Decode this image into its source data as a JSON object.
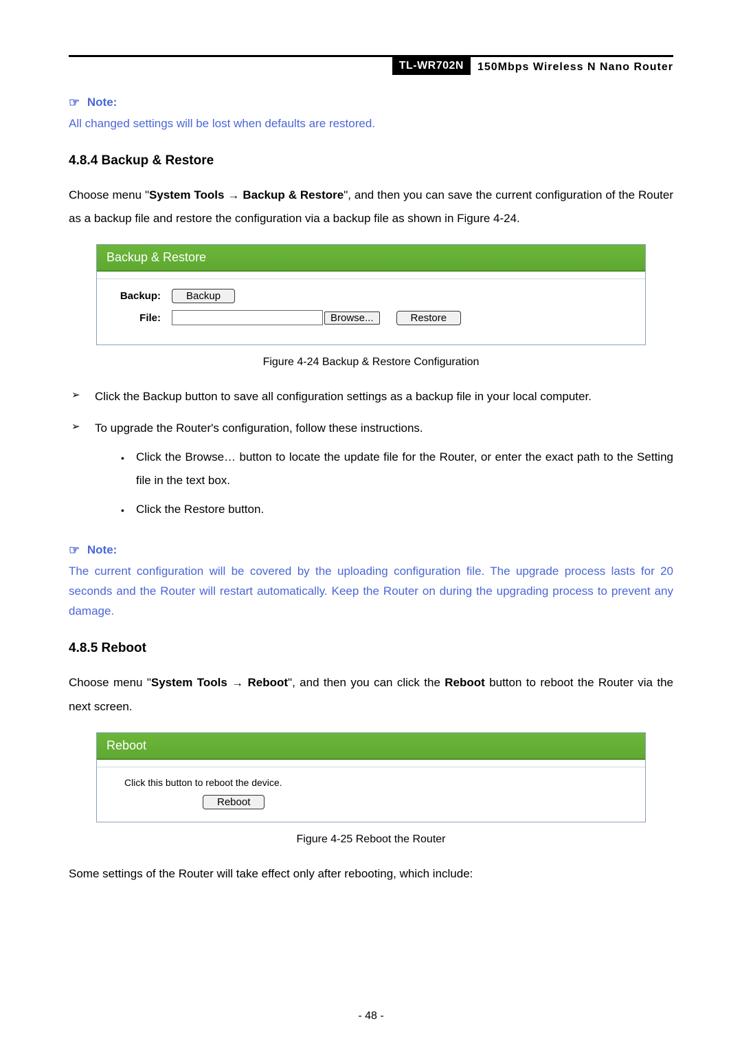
{
  "header": {
    "model": "TL-WR702N",
    "desc": "150Mbps Wireless N Nano Router"
  },
  "note1": {
    "label": "Note:",
    "body": "All changed settings will be lost when defaults are restored."
  },
  "section1": {
    "heading": "4.8.4  Backup & Restore",
    "para_parts": {
      "t1": "Choose menu \"",
      "b1": "System Tools",
      "arrow": " → ",
      "b2": "Backup & Restore",
      "t2": "\", and then you can save the current configuration of the Router as a backup file and restore the configuration via a backup file as shown in Figure 4-24."
    }
  },
  "panel1": {
    "title": "Backup & Restore",
    "label_backup": "Backup:",
    "label_file": "File:",
    "btn_backup": "Backup",
    "btn_browse": "Browse...",
    "btn_restore": "Restore"
  },
  "caption1": "Figure 4-24    Backup & Restore Configuration",
  "bullets": {
    "item1": {
      "t1": "Click the ",
      "b1": "Backup",
      "t2": " button to save all configuration settings as a backup file in your local computer."
    },
    "item2": {
      "t1": "To upgrade the Router's configuration, follow these instructions."
    },
    "sub1": {
      "t1": "Click the ",
      "b1": "Browse…",
      "t2": " button to locate the update file for the Router, or enter the exact path to the Setting file in the text box."
    },
    "sub2": {
      "t1": "Click the ",
      "b1": "Restore",
      "t2": " button."
    }
  },
  "note2": {
    "label": "Note:",
    "body": "The current configuration will be covered by the uploading configuration file. The upgrade process lasts for 20 seconds and the Router will restart automatically. Keep the Router on during the upgrading process to prevent any damage."
  },
  "section2": {
    "heading": "4.8.5  Reboot",
    "para_parts": {
      "t1": "Choose menu \"",
      "b1": "System Tools",
      "arrow": " → ",
      "b2": "Reboot",
      "t2": "\", and then you can click the ",
      "b3": "Reboot",
      "t3": " button to reboot the Router via the next screen."
    }
  },
  "panel2": {
    "title": "Reboot",
    "instruction": "Click this button to reboot the device.",
    "btn_reboot": "Reboot"
  },
  "caption2": "Figure 4-25 Reboot the Router",
  "trailing_para": "Some settings of the Router will take effect only after rebooting, which include:",
  "page_number": "- 48 -"
}
